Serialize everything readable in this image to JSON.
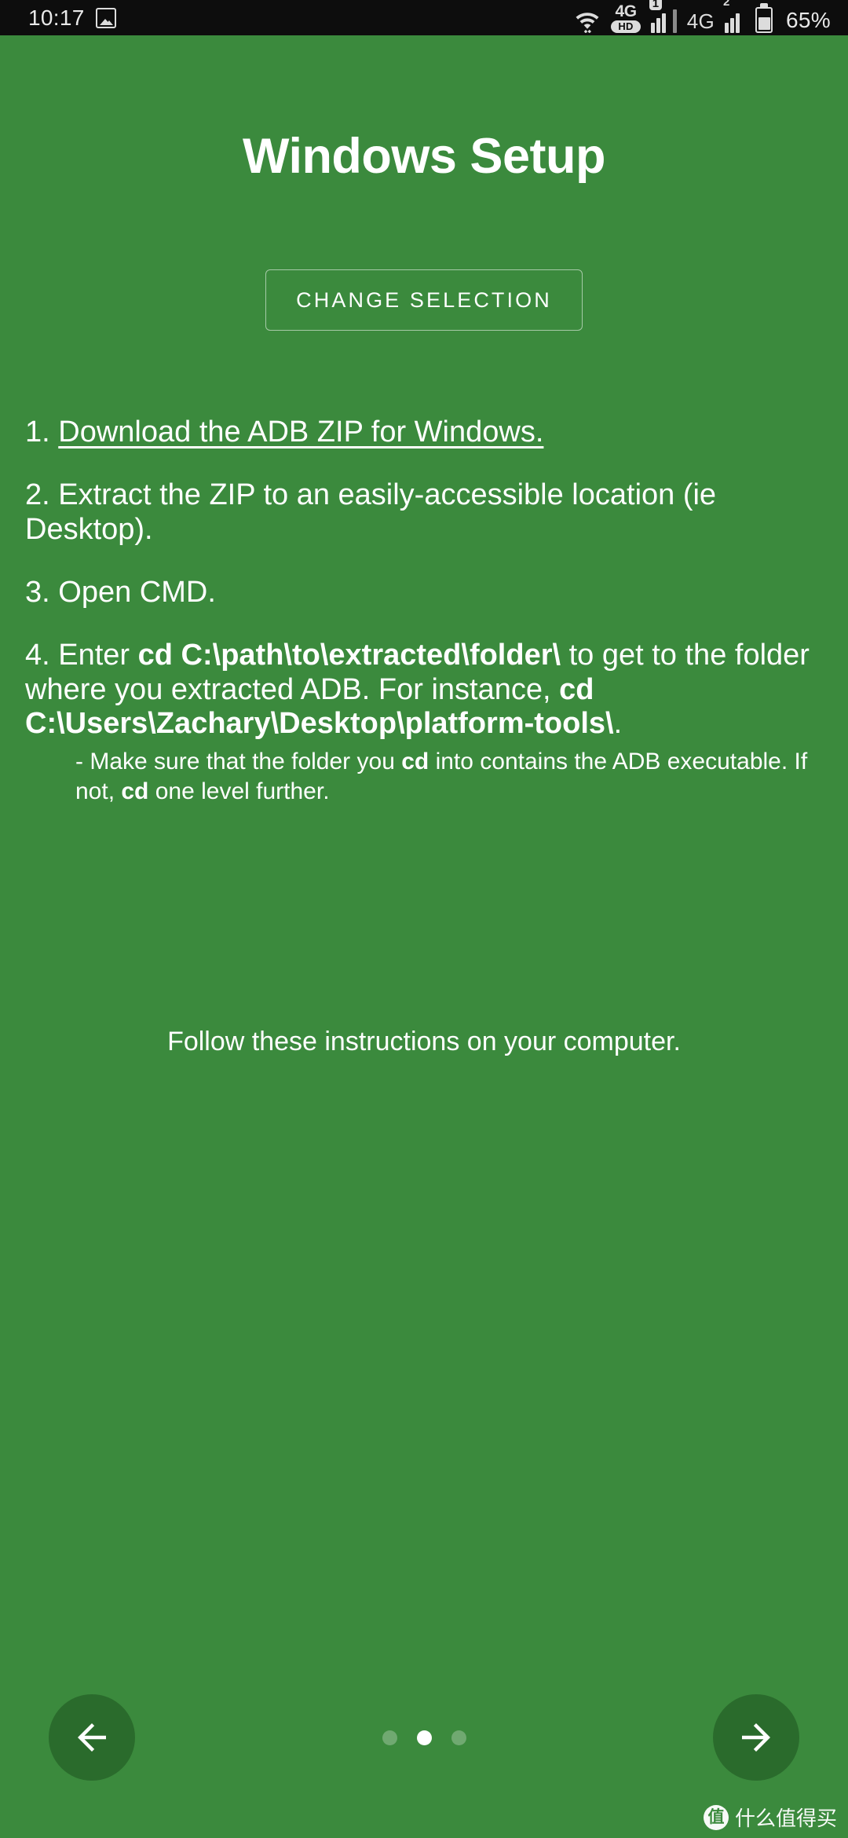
{
  "status_bar": {
    "time": "10:17",
    "photo_icon": "photo-icon",
    "wifi_icon": "wifi-icon",
    "volte_label": "4G",
    "volte_hd_label": "HD",
    "sim1_number": "1",
    "sim1_signal_icon": "signal-bars-icon",
    "sim2_network": "4G",
    "sim2_number": "2",
    "sim2_signal_icon": "signal-bars-icon",
    "battery_icon": "battery-icon",
    "battery_percent": "65%"
  },
  "page": {
    "title": "Windows Setup",
    "change_selection_label": "CHANGE SELECTION",
    "follow_text": "Follow these instructions on your computer.",
    "background_color": "#3b8a3d",
    "fab_color": "#2a6b2c",
    "text_color": "#ffffff"
  },
  "steps": [
    {
      "number": "1.",
      "link_text": "Download the ADB ZIP for Windows.",
      "is_link": true
    },
    {
      "number": "2.",
      "text": "Extract the ZIP to an easily-accessible location (ie Desktop).",
      "is_link": false
    },
    {
      "number": "3.",
      "text": "Open CMD.",
      "is_link": false
    },
    {
      "number": "4.",
      "text_part1": "Enter ",
      "bold1": "cd C:\\path\\to\\extracted\\folder\\",
      "text_part2": " to get to the folder where you extracted ADB. For instance, ",
      "bold2": "cd C:\\Users\\Zachary\\Desktop\\platform-tools\\",
      "text_part3": ".",
      "is_link": false
    }
  ],
  "substep": {
    "part1": "- Make sure that the folder you ",
    "bold1": "cd",
    "part2": " into contains the ADB executable. If not, ",
    "bold2": "cd",
    "part3": " one level further."
  },
  "nav": {
    "back_icon": "arrow-left-icon",
    "forward_icon": "arrow-right-icon",
    "dots_total": 3,
    "dots_active_index": 1
  },
  "watermark": {
    "logo_glyph": "值",
    "text": "什么值得买"
  }
}
